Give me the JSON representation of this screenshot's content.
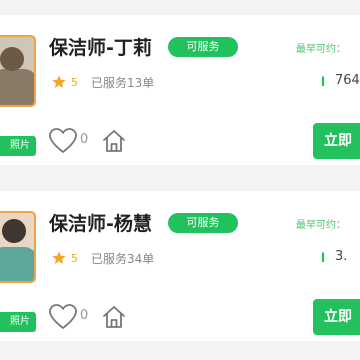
{
  "cards": [
    {
      "name": "保洁师-丁莉",
      "status": "可服务",
      "earliest_label": "最早可约：",
      "rating": "5",
      "served": "已服务13单",
      "price": "764",
      "like_count": "0",
      "photo_badge": "照片",
      "book_label": "立即"
    },
    {
      "name": "保洁师-杨慧",
      "status": "可服务",
      "earliest_label": "最早可约：",
      "rating": "5",
      "served": "已服务34单",
      "price": "3.",
      "like_count": "0",
      "photo_badge": "照片",
      "book_label": "立即"
    }
  ],
  "colors": {
    "accent_green": "#22c15e",
    "star_orange": "#f5a623",
    "avatar_border": "#f0a44a"
  },
  "icons": [
    "star-icon",
    "heart-icon",
    "home-icon",
    "price-icon"
  ]
}
